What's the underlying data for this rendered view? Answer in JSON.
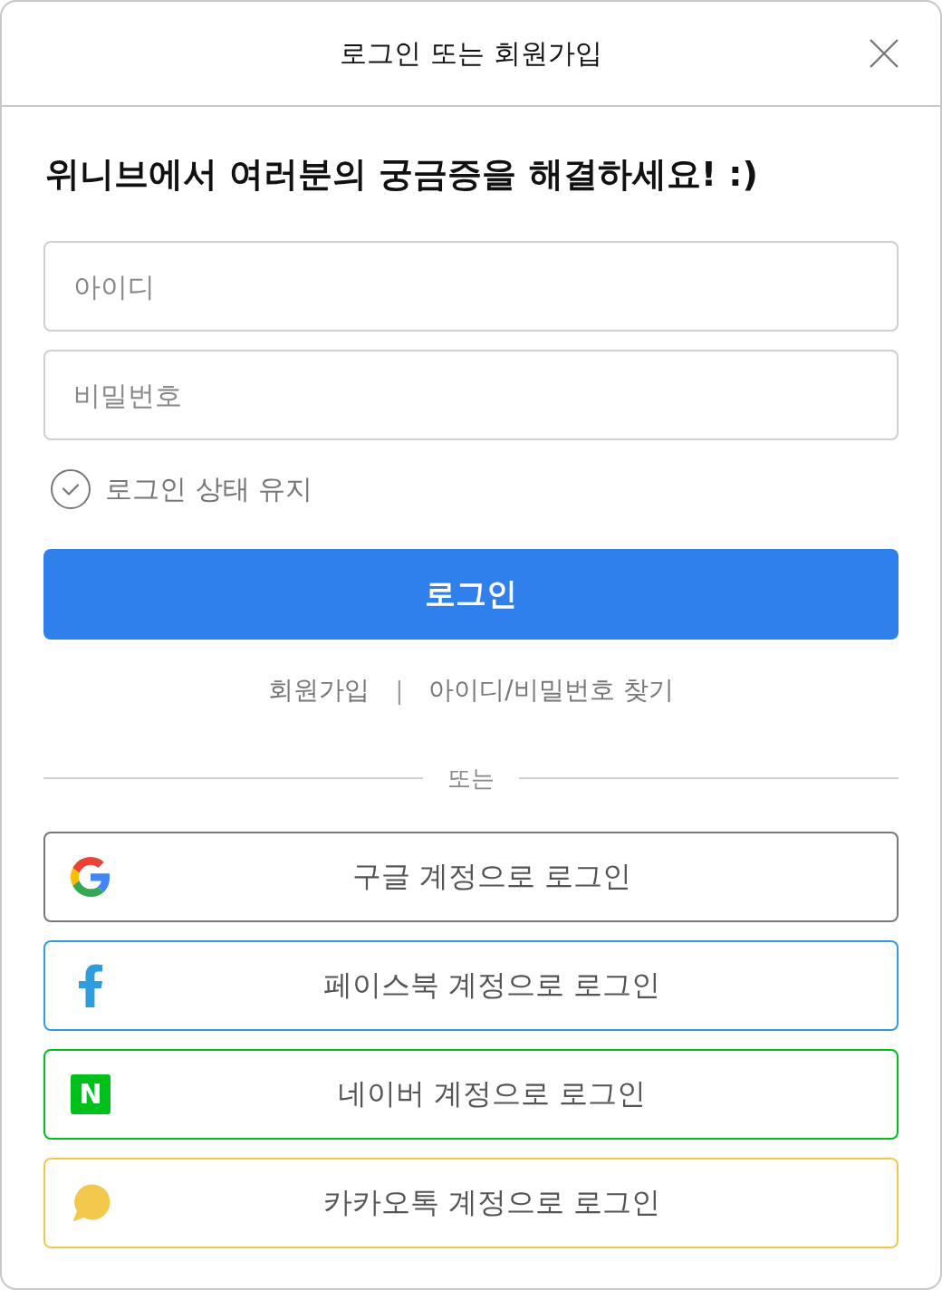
{
  "header": {
    "title": "로그인 또는 회원가입"
  },
  "heading": "위니브에서 여러분의 궁금증을 해결하세요! :)",
  "fields": [
    {
      "placeholder": "아이디"
    },
    {
      "placeholder": "비밀번호"
    }
  ],
  "keep_login": {
    "label": "로그인 상태 유지",
    "checked": false
  },
  "login_button": {
    "label": "로그인"
  },
  "links": [
    {
      "label": "회원가입"
    },
    {
      "label": "아이디/비밀번호 찾기"
    }
  ],
  "link_separator": "|",
  "divider": {
    "label": "또는"
  },
  "social_buttons": [
    {
      "kind": "google",
      "label": "구글 계정으로 로그인",
      "color": "#777777"
    },
    {
      "kind": "facebook",
      "label": "페이스북 계정으로 로그인",
      "color": "#2d9ddf"
    },
    {
      "kind": "naver",
      "label": "네이버 계정으로 로그인",
      "color": "#00c01c",
      "icon_text": "N"
    },
    {
      "kind": "kakao",
      "label": "카카오톡 계정으로 로그인",
      "color": "#f2c94c"
    }
  ]
}
